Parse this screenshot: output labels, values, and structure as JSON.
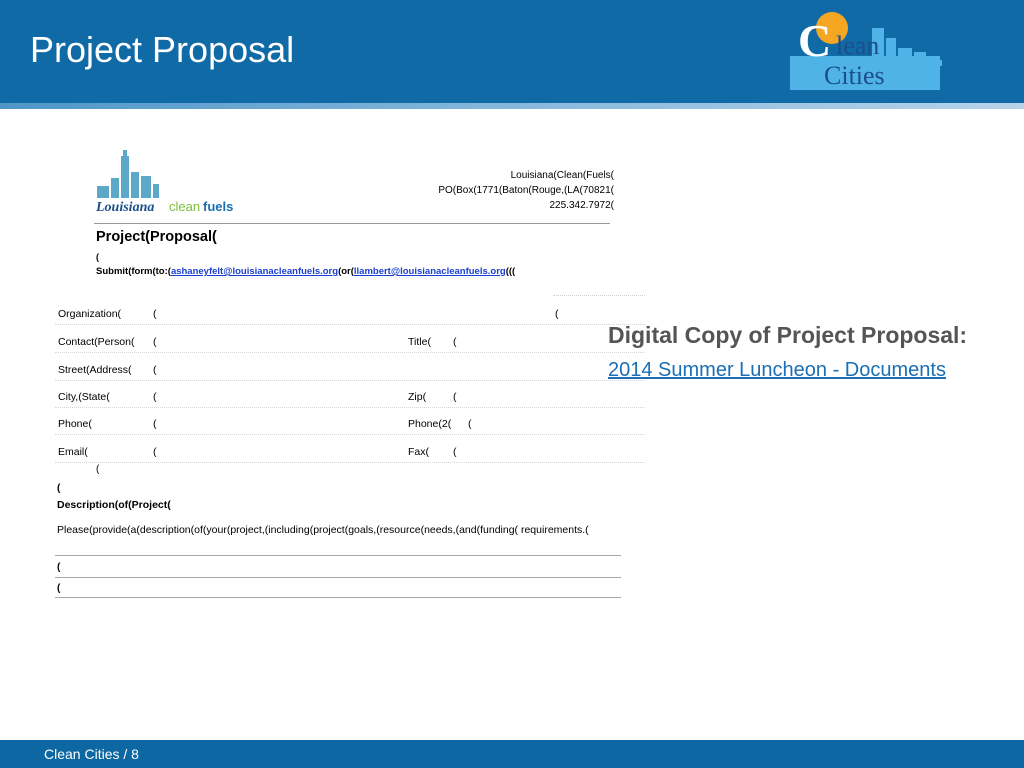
{
  "slide": {
    "title": "Project Proposal",
    "footer": "Clean Cities  /  8"
  },
  "logo": {
    "brand": "Clean Cities",
    "line1": "lean",
    "line2": "Cities"
  },
  "document": {
    "logo_text_1": "Louisiana",
    "logo_text_2": "clean",
    "logo_text_3": "fuels",
    "address": [
      "Louisiana(Clean(Fuels(",
      "PO(Box(1771(Baton(Rouge,(LA(70821(",
      "225.342.7972("
    ],
    "title": "Project(Proposal(",
    "paren": "(",
    "submit_prefix": "Submit(form(to:(",
    "email1": "ashaneyfelt@louisianacleanfuels.org",
    "submit_or": "(or(",
    "email2": "llambert@louisianacleanfuels.org",
    "submit_suffix": "(((",
    "rows": [
      {
        "label": "Organization(",
        "col2": "(",
        "col3_label": "",
        "col3": "",
        "col4": "("
      },
      {
        "label": "Contact(Person(",
        "col2": "(",
        "col3_label": "Title(",
        "col3": "(",
        "col4": ""
      },
      {
        "label": "Street(Address(",
        "col2": "(",
        "col3_label": "",
        "col3": "",
        "col4": ""
      },
      {
        "label": "City,(State(",
        "col2": "(",
        "col3_label": "Zip(",
        "col3": "(",
        "col4": ""
      },
      {
        "label": "Phone(",
        "col2": "(",
        "col3_label": "Phone(2(",
        "col3": "(",
        "col4": ""
      },
      {
        "label": "Email(",
        "col2": "(",
        "col3_label": "Fax(",
        "col3": "(",
        "col4": ""
      }
    ],
    "after_table_paren": "(",
    "desc_paren": "(",
    "desc_title": "Description(of(Project(",
    "desc_text": "Please(provide(a(description(of(your(project,(including(project(goals,(resource(needs,(and(funding( requirements.(",
    "blank1": "(",
    "blank2": "("
  },
  "side": {
    "heading": "Digital Copy of Project Proposal:",
    "link": "2014 Summer Luncheon - Documents"
  },
  "colors": {
    "header_blue": "#106aa6",
    "footer_blue": "#0d67a3",
    "link_blue": "#1a6fb5",
    "heading_gray": "#555555"
  }
}
